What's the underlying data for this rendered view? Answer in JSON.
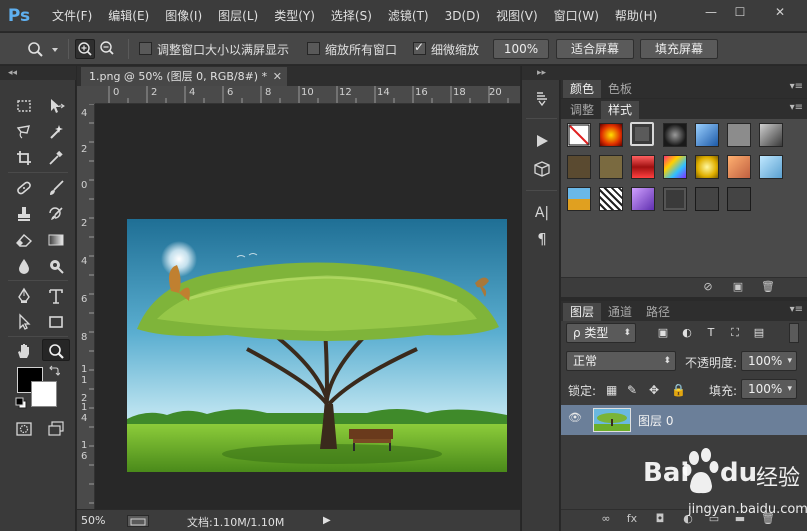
{
  "app": {
    "logo": "Ps"
  },
  "menu": {
    "items": [
      "文件(F)",
      "编辑(E)",
      "图像(I)",
      "图层(L)",
      "类型(Y)",
      "选择(S)",
      "滤镜(T)",
      "3D(D)",
      "视图(V)",
      "窗口(W)",
      "帮助(H)"
    ]
  },
  "window_controls": {
    "minimize": "—",
    "maximize": "☐",
    "close": "✕"
  },
  "options_bar": {
    "check_resize_window": {
      "label": "调整窗口大小以满屏显示",
      "checked": false
    },
    "check_zoom_all": {
      "label": "缩放所有窗口",
      "checked": false
    },
    "check_scrubby": {
      "label": "细微缩放",
      "checked": true
    },
    "btn_100": "100%",
    "btn_fit": "适合屏幕",
    "btn_fill": "填充屏幕"
  },
  "toolbar": {
    "collapse_glyph": "◂◂"
  },
  "document": {
    "tab_title": "1.png @ 50% (图层 0, RGB/8#) *",
    "tab_close": "✕",
    "ruler_top": [
      "0",
      "2",
      "4",
      "6",
      "8",
      "10",
      "12",
      "14",
      "16",
      "18",
      "20"
    ],
    "ruler_left": [
      "4",
      "2",
      "0",
      "2",
      "4",
      "6",
      "8",
      "1",
      "1",
      "2",
      "1",
      "4",
      "1",
      "6"
    ],
    "zoom": "50%",
    "doc_size": "文档:1.10M/1.10M",
    "status_arrow": "▶"
  },
  "mid_strip": {
    "collapse_glyph": "▸▸",
    "char_label": "A|",
    "para_label": "¶"
  },
  "panels": {
    "color_tabs": [
      "颜色",
      "色板"
    ],
    "style_tabs": [
      "调整",
      "样式"
    ],
    "menu_glyph": "▾≡",
    "layers_tabs": [
      "图层",
      "通道",
      "路径"
    ],
    "filter_kind": "ρ 类型",
    "blend_mode": "正常",
    "opacity_label": "不透明度:",
    "opacity_value": "100%",
    "lock_label": "锁定:",
    "fill_label": "填充:",
    "fill_value": "100%",
    "layer_name": "图层 0",
    "layer_visible_glyph": "👁",
    "footer": [
      "∞",
      "fx",
      "◘",
      "◐",
      "▭",
      "▬",
      "🗑"
    ]
  },
  "watermark": {
    "brand": "Bai",
    "brand_du": "du",
    "brand_cn": "经验",
    "url": "jingyan.baidu.com"
  },
  "colors": {
    "accent_blue": "#5fb0f0",
    "selected_layer": "#6b7f99"
  }
}
